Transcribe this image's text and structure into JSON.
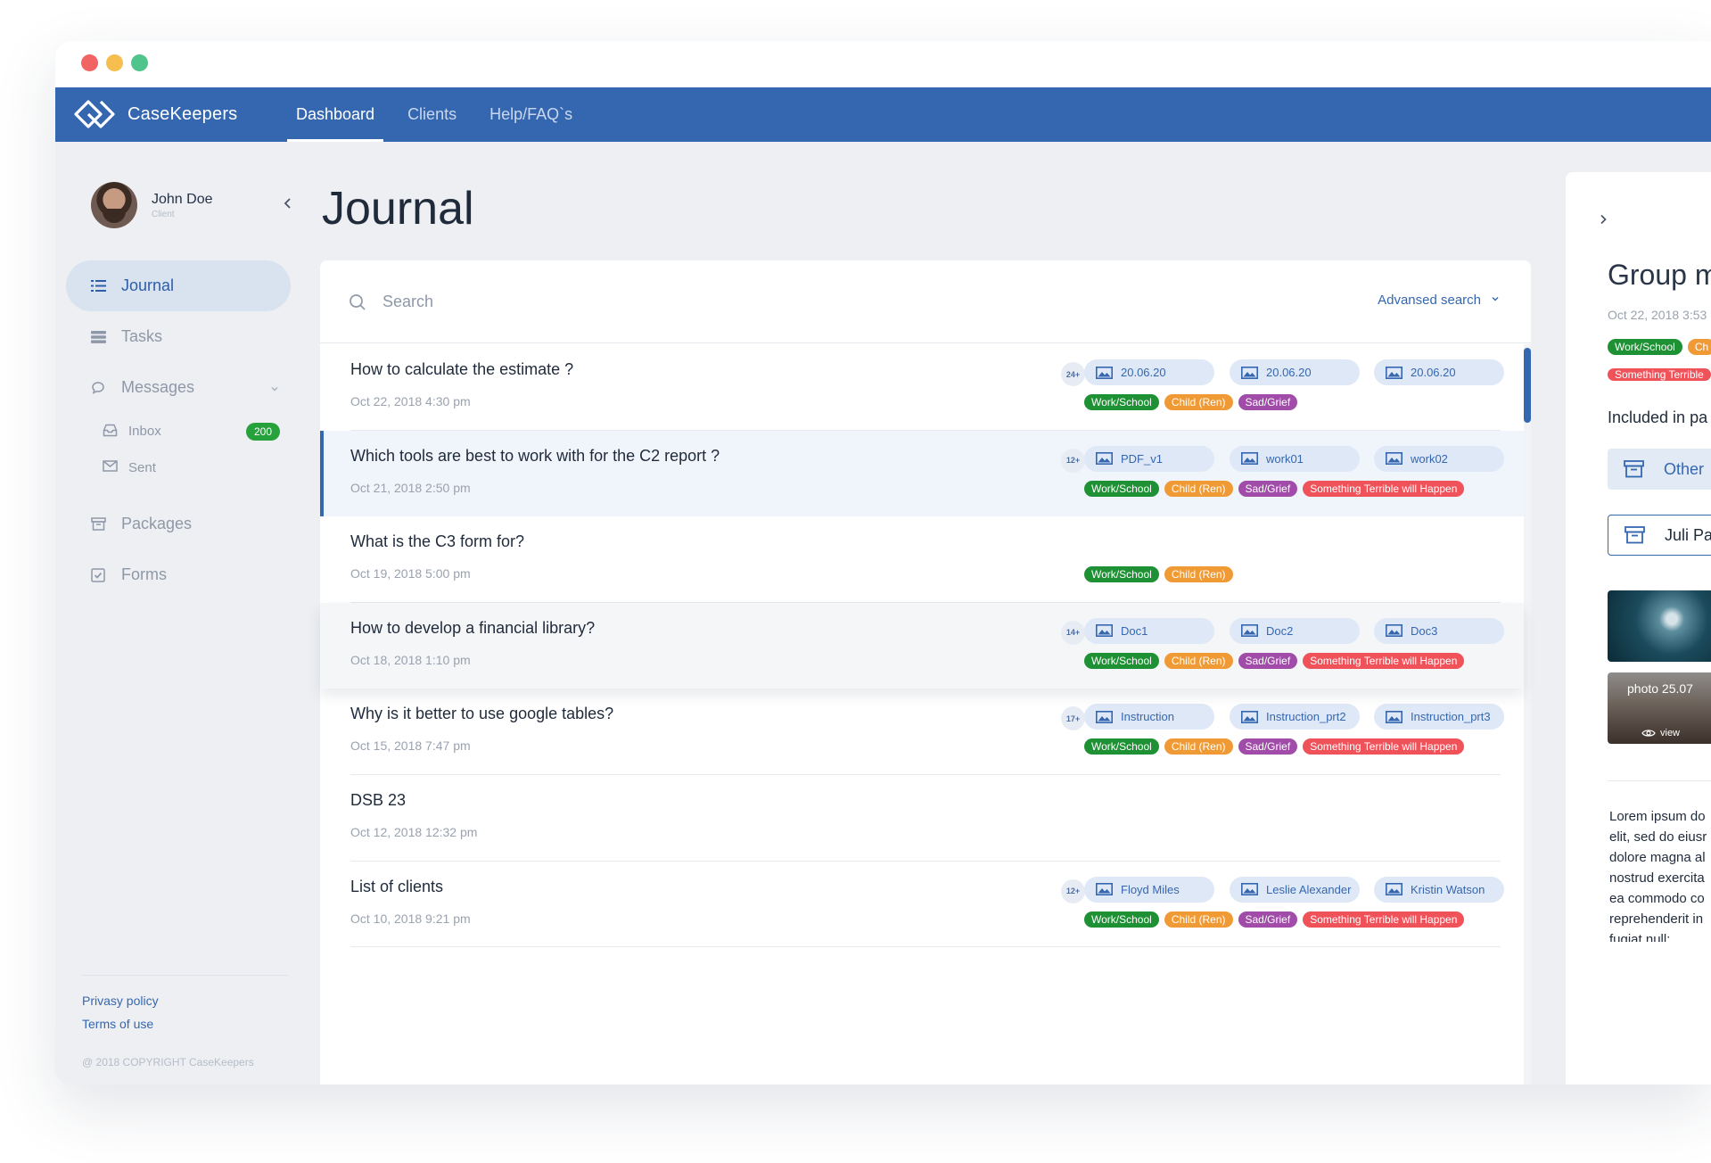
{
  "app": {
    "name": "CaseKeepers"
  },
  "nav": {
    "tabs": [
      {
        "label": "Dashboard",
        "active": true
      },
      {
        "label": "Clients"
      },
      {
        "label": "Help/FAQ`s"
      }
    ]
  },
  "user": {
    "name": "John Doe",
    "role": "Client"
  },
  "sidebar": {
    "journal": "Journal",
    "tasks": "Tasks",
    "messages": "Messages",
    "inbox": "Inbox",
    "inbox_count": "200",
    "sent": "Sent",
    "packages": "Packages",
    "forms": "Forms",
    "privacy": "Privasy policy",
    "terms": "Terms of use",
    "copyright": "@ 2018 COPYRIGHT CaseKeepers"
  },
  "page": {
    "title": "Journal"
  },
  "search": {
    "placeholder": "Search",
    "advanced": "Advansed search"
  },
  "entries": [
    {
      "title": "How to calculate the estimate ?",
      "date": "Oct 22, 2018 4:30 pm",
      "count": "24+",
      "attachments": [
        "20.06.20",
        "20.06.20",
        "20.06.20"
      ],
      "tags": [
        "Work/School",
        "Child (Ren)",
        "Sad/Grief"
      ]
    },
    {
      "title": "Which tools are best to work with for the C2 report ?",
      "date": "Oct 21, 2018 2:50 pm",
      "count": "12+",
      "attachments": [
        "PDF_v1",
        "work01",
        "work02"
      ],
      "tags": [
        "Work/School",
        "Child (Ren)",
        "Sad/Grief",
        "Something Terrible will Happen"
      ]
    },
    {
      "title": "What is the C3 form for?",
      "date": "Oct 19, 2018 5:00 pm",
      "tags": [
        "Work/School",
        "Child (Ren)"
      ]
    },
    {
      "title": "How to develop a financial library?",
      "date": "Oct 18, 2018 1:10 pm",
      "count": "14+",
      "attachments": [
        "Doc1",
        "Doc2",
        "Doc3"
      ],
      "tags": [
        "Work/School",
        "Child (Ren)",
        "Sad/Grief",
        "Something Terrible will Happen"
      ]
    },
    {
      "title": "Why is it better to use google tables?",
      "date": "Oct 15, 2018 7:47 pm",
      "count": "17+",
      "attachments": [
        "Instruction",
        "Instruction_prt2",
        "Instruction_prt3"
      ],
      "tags": [
        "Work/School",
        "Child (Ren)",
        "Sad/Grief",
        "Something Terrible will Happen"
      ]
    },
    {
      "title": "DSB 23",
      "date": "Oct 12, 2018 12:32 pm"
    },
    {
      "title": "List of clients",
      "date": "Oct 10, 2018 9:21 pm",
      "count": "12+",
      "attachments": [
        "Floyd Miles",
        "Leslie Alexander",
        "Kristin Watson"
      ],
      "tags": [
        "Work/School",
        "Child (Ren)",
        "Sad/Grief",
        "Something Terrible will Happen"
      ]
    }
  ],
  "detail": {
    "title": "Group m",
    "date": "Oct 22, 2018 3:53",
    "tags": [
      "Work/School",
      "Ch"
    ],
    "tag_red": "Something Terrible",
    "included": "Included in pa",
    "btn_other": "Other",
    "btn_juli": "Juli Pa",
    "photo_caption": "photo 25.07",
    "view": "view",
    "text_lines": [
      "Lorem ipsum do",
      "elit, sed do eiusr",
      "dolore magna al",
      "nostrud exercita",
      "ea commodo co",
      "reprehenderit in",
      "fugiat null:"
    ]
  },
  "colors": {
    "brand": "#3567b0",
    "tag_work": "#1f9135",
    "tag_child": "#f09a36",
    "tag_sad": "#a04ca8",
    "tag_terrible": "#f0525a",
    "inbox_badge": "#27a13c"
  }
}
